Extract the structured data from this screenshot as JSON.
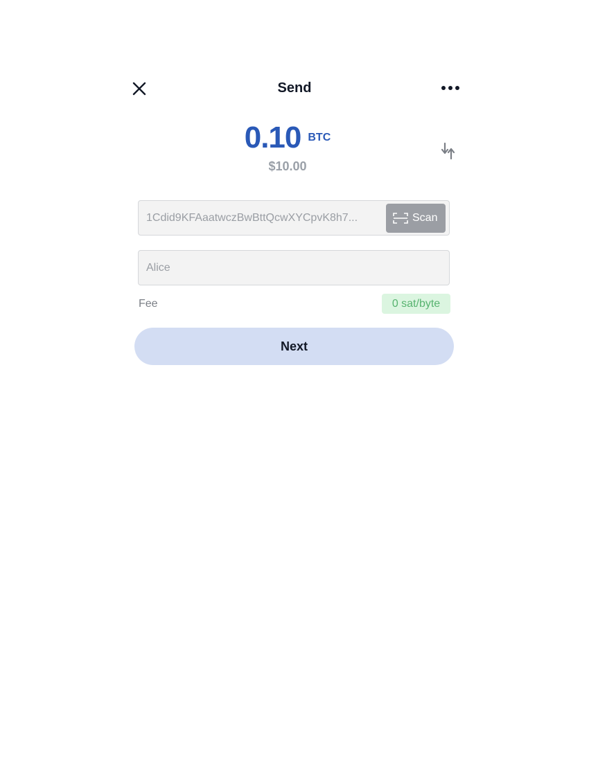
{
  "header": {
    "title": "Send",
    "close_icon": "close-icon",
    "more_icon": "more-horizontal-icon"
  },
  "amount": {
    "value": "0.10",
    "unit": "BTC",
    "fiat": "$10.00",
    "swap_icon": "swap-vertical-icon"
  },
  "address": {
    "value": "1Cdid9KFAaatwczBwBttQcwXYCpvK8h7...",
    "scan_label": "Scan",
    "scan_icon": "scan-icon"
  },
  "note": {
    "value": "Alice"
  },
  "fee": {
    "label": "Fee",
    "value": "0 sat/byte"
  },
  "next_button": {
    "label": "Next"
  },
  "colors": {
    "accent": "#2a59b7",
    "title": "#121826",
    "muted": "#9aa0a8",
    "fee_badge_bg": "#dbf5e0",
    "fee_badge_text": "#57b36f",
    "next_bg": "#d3ddf3",
    "scan_bg": "#9b9ea4"
  }
}
